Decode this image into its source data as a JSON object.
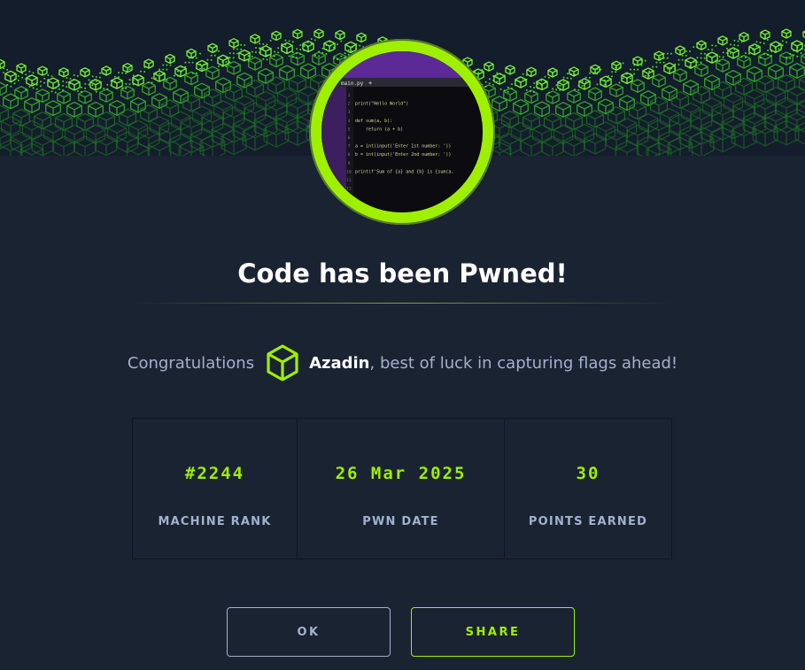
{
  "banner": {
    "icon": "green-cube-wave-pattern"
  },
  "avatar": {
    "icon": "code-editor-screenshot",
    "editor_tab": "main.py",
    "editor_plus": "+",
    "code_lines": [
      {
        "no": "1",
        "text": ""
      },
      {
        "no": "2",
        "text": "print(\"Hello World\")"
      },
      {
        "no": "3",
        "text": ""
      },
      {
        "no": "4",
        "text": "def sum(a, b):"
      },
      {
        "no": "5",
        "text": "    return (a + b)"
      },
      {
        "no": "6",
        "text": ""
      },
      {
        "no": "7",
        "text": "a = int(input('Enter 1st number: '))"
      },
      {
        "no": "8",
        "text": "b = int(input('Enter 2nd number: '))"
      },
      {
        "no": "9",
        "text": ""
      },
      {
        "no": "10",
        "text": "print(f'Sum of {a} and {b} is {sum(a,"
      },
      {
        "no": "11",
        "text": ""
      },
      {
        "no": "12",
        "text": ""
      }
    ]
  },
  "title": "Code has been Pwned!",
  "congrats": {
    "prefix": "Congratulations",
    "user_icon": "cube-icon",
    "username": "Azadin",
    "suffix": ", best of luck in capturing flags ahead!"
  },
  "stats": [
    {
      "value": "#2244",
      "label": "MACHINE RANK"
    },
    {
      "value": "26 Mar 2025",
      "label": "PWN DATE"
    },
    {
      "value": "30",
      "label": "POINTS EARNED"
    }
  ],
  "buttons": {
    "ok": "OK",
    "share": "SHARE"
  },
  "colors": {
    "accent": "#9fef00",
    "background": "#1a2332",
    "text": "#a4b1cd"
  }
}
